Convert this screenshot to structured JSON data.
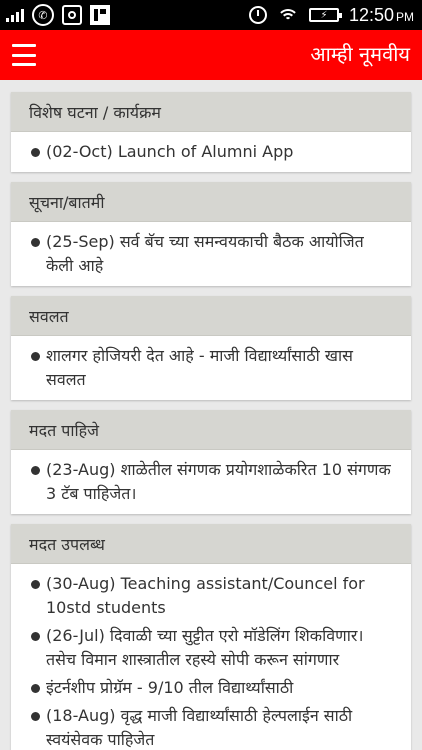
{
  "status_bar": {
    "time": "12:50",
    "ampm": "PM",
    "battery_label": "",
    "icons": [
      "signal-icon",
      "phone-icon",
      "app-icon",
      "flipboard-icon",
      "alarm-icon",
      "wifi-icon",
      "battery-icon"
    ]
  },
  "app_bar": {
    "title": "आम्ही नूमवीय",
    "menu_icon": "hamburger-menu-icon",
    "color": "#ff0000"
  },
  "sections": [
    {
      "title": "विशेष घटना / कार्यक्रम",
      "items": [
        "(02-Oct) Launch of Alumni App"
      ]
    },
    {
      "title": "सूचना/बातमी",
      "items": [
        "(25-Sep) सर्व बॅच च्या समन्वयकाची बैठक आयोजित केली आहे"
      ]
    },
    {
      "title": "सवलत",
      "items": [
        "शालगर होजियरी देत आहे - माजी विद्यार्थ्यांसाठी खास सवलत"
      ]
    },
    {
      "title": "मदत पाहिजे",
      "items": [
        "(23-Aug) शाळेतील संगणक प्रयोगशाळेकरित 10 संगणक 3 टॅब पाहिजेत।"
      ]
    },
    {
      "title": "मदत उपलब्ध",
      "items": [
        "(30-Aug) Teaching assistant/Councel for 10std students",
        "(26-Jul) दिवाळी च्या सुट्टीत एरो मॉडेलिंग शिकविणार। तसेच विमान शास्त्रातील रहस्ये सोपी करून सांगणार",
        "इंटर्नशीप प्रोग्रॅम - 9/10 तील विद्यार्थ्यांसाठी",
        "(18-Aug) वृद्ध माजी विद्यार्थ्यांसाठी हेल्पलाईन साठी स्वयंसेवक पाहिजेत"
      ]
    }
  ]
}
